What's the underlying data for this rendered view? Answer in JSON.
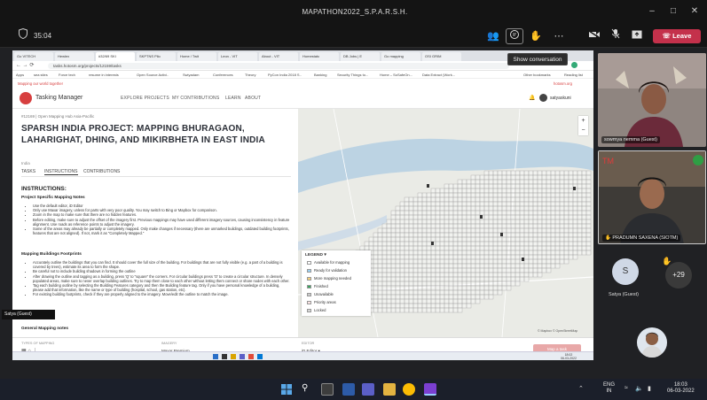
{
  "window": {
    "title": "MAPATHON2022_S.P.A.R.S.H.",
    "min_icon": "minimize-icon",
    "max_icon": "maximize-icon",
    "close_icon": "close-icon"
  },
  "meeting_toolbar": {
    "shield_icon": "shield-icon",
    "timer": "35:04",
    "leave_label": "Leave",
    "tooltip": "Show conversation"
  },
  "browser": {
    "tabs": [
      "Go VITECH",
      "Hewlex",
      "#32/69 SKI",
      "SKPTNS Pllo",
      "Home / Twit",
      "Leon - VIT",
      "About - VIT",
      "Homestatc",
      "DB Jobs | E",
      "Go mapping",
      "OSI GRIM"
    ],
    "url": "tasks.hotosm.org/projects/12159/tasks",
    "bookmarks": [
      "Apps",
      "sea sties",
      "Force tech",
      "resume in interests",
      "Open Source Activi..",
      "Swiyadam",
      "Conferences",
      "Theory",
      "PyCon India 2018 S..",
      "Banking",
      "Security Things to...",
      "Home – SoSafeOn...",
      "Data Extract (Work..."
    ],
    "other_bookmarks": "Other bookmarks",
    "reading_list": "Reading list"
  },
  "tasking_manager": {
    "notice": "Mapping our world together",
    "notice_right": "hotosm.org",
    "app_name": "Tasking Manager",
    "nav": [
      "EXPLORE PROJECTS",
      "MY CONTRIBUTIONS",
      "LEARN",
      "ABOUT"
    ],
    "user": "satyaskuni",
    "project_id": "#12169 | Open Mapping Hub Asia-Pacific",
    "project_title": "SPARSH INDIA PROJECT: MAPPING BHURAGAON, LAHARIGHAT, DHING, AND MIKIRBHETA IN EAST INDIA",
    "location": "India",
    "tabs": [
      "TASKS",
      "INSTRUCTIONS",
      "CONTRIBUTIONS"
    ],
    "instructions_heading": "INSTRUCTIONS:",
    "section1_title": "Project Specific Mapping Notes",
    "section1_items": [
      "Use the default editor, iD Editor",
      "Only use Maxar imagery, unless for parts with very poor quality. You may switch to Bing or Mapbox for comparison.",
      "Zoom in the map to make sure that there are no hidden features.",
      "Before editing, make sure to adjust the offset of the imagery first. Previous mappings may have used different imagery sources, causing inconsistency in feature alignment. Use roads as reference points to adjust the imagery.",
      "Some of the areas may already be partially or completely mapped. Only make changes if necessary (there are unmarked buildings, outdated building footprints, features that are not aligned). If not, mark it as \"Completely Mapped.\""
    ],
    "section2_title": "Mapping Buildings Footprints",
    "section2_items": [
      "Accurately outline the buildings that you can find. It should cover the full size of the building. For buildings that are not fully visible (e.g. a part of a building is covered by trees), estimate its area to form the shape.",
      "Be careful not to include building shadows in forming the outline",
      "After drawing the outline and tagging as a building, press 'Q' to \"square\" the corners. For circular buildings press 'O' to create a circular structure. In densely populated areas, make sure to never overlap building outlines. Try to map them close to each other without letting them connect or share nodes with each other.",
      "Tag each building outline by selecting the Building Features category and then the Building feature tag. Only if you have personal knowledge of a building, please add that information, like the name or type of building (hospital, school, gas station, etc).",
      "For existing building footprints, check if they are properly aligned to the imagery. Move/edit the outline to match the image."
    ],
    "section3_title": "General Mapping notes",
    "footer": {
      "types_label": "TYPES OF MAPPING",
      "imagery_label": "IMAGERY",
      "imagery_value": "Maxar Premium",
      "editor_label": "EDITOR",
      "editor_value": "iD Editor",
      "map_button": "Map a task"
    },
    "legend": {
      "title": "LEGEND",
      "items": [
        {
          "label": "Available for mapping",
          "color": "#ffffff"
        },
        {
          "label": "Ready for validation",
          "color": "#9bd0f0"
        },
        {
          "label": "More mapping needed",
          "color": "#f6d07a"
        },
        {
          "label": "Finished",
          "color": "#3aa35f"
        },
        {
          "label": "Unavailable",
          "color": "#cccccc"
        },
        {
          "label": "Priority areas",
          "color": "#fbe4e4"
        },
        {
          "label": "Locked",
          "color": "#d6d6d6"
        }
      ]
    },
    "map_credit": "© Mapbox © OpenStreetMap"
  },
  "presenter": {
    "name": "Satya (Guest)"
  },
  "participants": [
    {
      "name": "sowmya nemma (Guest)"
    },
    {
      "name": "PRADUMN SAXENA (SIOTM)"
    },
    {
      "name": "Satya (Guest)",
      "initial": "S"
    }
  ],
  "overflow_count": "+29",
  "taskbar": {
    "lang_top": "ENG",
    "lang_bottom": "IN",
    "time": "18:03",
    "date": "06-03-2022",
    "inner_time": "18:02",
    "inner_date": "06-03-2022"
  }
}
